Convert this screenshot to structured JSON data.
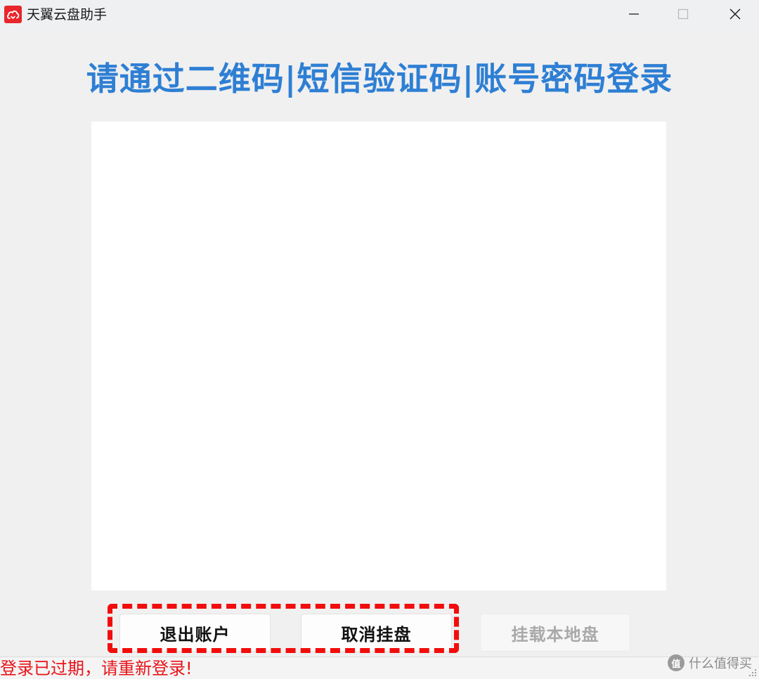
{
  "window": {
    "title": "天翼云盘助手",
    "app_icon": "cloud-icon",
    "controls": {
      "minimize": "minimize-icon",
      "maximize": "maximize-icon",
      "close": "close-icon"
    }
  },
  "main": {
    "heading": "请通过二维码|短信验证码|账号密码登录",
    "heading_color": "#2e7fd4"
  },
  "buttons": {
    "logout": "退出账户",
    "cancel_mount": "取消挂盘",
    "mount_local": "挂载本地盘"
  },
  "annotation": {
    "color": "#f20d0d"
  },
  "status": {
    "message": "登录已过期，请重新登录!",
    "color": "#e8141a"
  },
  "watermark": {
    "text": "什么值得买",
    "logo": "值"
  }
}
